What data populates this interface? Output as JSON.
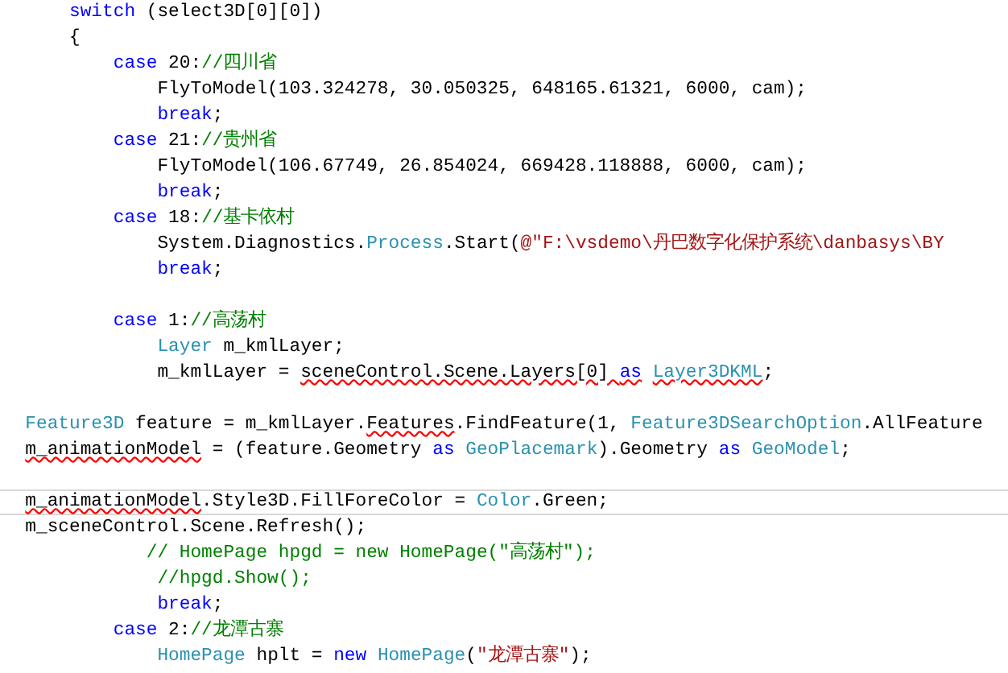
{
  "editor": {
    "lines": [
      {
        "current": false,
        "tokens": [
          {
            "text": "      switch",
            "kind": "kw",
            "error": false
          },
          {
            "text": " (select3D[0][0])",
            "kind": "tx",
            "error": false
          }
        ]
      },
      {
        "current": false,
        "tokens": [
          {
            "text": "      {",
            "kind": "tx",
            "error": false
          }
        ]
      },
      {
        "current": false,
        "tokens": [
          {
            "text": "          case",
            "kind": "kw",
            "error": false
          },
          {
            "text": " 20:",
            "kind": "tx",
            "error": false
          },
          {
            "text": "//四川省",
            "kind": "cm",
            "error": false
          }
        ]
      },
      {
        "current": false,
        "tokens": [
          {
            "text": "              FlyToModel(103.324278, 30.050325, 648165.61321, 6000, cam);",
            "kind": "tx",
            "error": false
          }
        ]
      },
      {
        "current": false,
        "tokens": [
          {
            "text": "              break",
            "kind": "kw",
            "error": false
          },
          {
            "text": ";",
            "kind": "tx",
            "error": false
          }
        ]
      },
      {
        "current": false,
        "tokens": [
          {
            "text": "          case",
            "kind": "kw",
            "error": false
          },
          {
            "text": " 21:",
            "kind": "tx",
            "error": false
          },
          {
            "text": "//贵州省",
            "kind": "cm",
            "error": false
          }
        ]
      },
      {
        "current": false,
        "tokens": [
          {
            "text": "              FlyToModel(106.67749, 26.854024, 669428.118888, 6000, cam);",
            "kind": "tx",
            "error": false
          }
        ]
      },
      {
        "current": false,
        "tokens": [
          {
            "text": "              break",
            "kind": "kw",
            "error": false
          },
          {
            "text": ";",
            "kind": "tx",
            "error": false
          }
        ]
      },
      {
        "current": false,
        "tokens": [
          {
            "text": "          case",
            "kind": "kw",
            "error": false
          },
          {
            "text": " 18:",
            "kind": "tx",
            "error": false
          },
          {
            "text": "//基卡依村",
            "kind": "cm",
            "error": false
          }
        ]
      },
      {
        "current": false,
        "tokens": [
          {
            "text": "              System.Diagnostics.",
            "kind": "tx",
            "error": false
          },
          {
            "text": "Process",
            "kind": "ty",
            "error": false
          },
          {
            "text": ".Start(",
            "kind": "tx",
            "error": false
          },
          {
            "text": "@\"F:\\vsdemo\\丹巴数字化保护系统\\danbasys\\BY",
            "kind": "str",
            "error": false
          }
        ]
      },
      {
        "current": false,
        "tokens": [
          {
            "text": "              break",
            "kind": "kw",
            "error": false
          },
          {
            "text": ";",
            "kind": "tx",
            "error": false
          }
        ]
      },
      {
        "current": false
      },
      {
        "current": false,
        "tokens": [
          {
            "text": "          case",
            "kind": "kw",
            "error": false
          },
          {
            "text": " 1:",
            "kind": "tx",
            "error": false
          },
          {
            "text": "//高荡村",
            "kind": "cm",
            "error": false
          }
        ]
      },
      {
        "current": false,
        "tokens": [
          {
            "text": "              Layer",
            "kind": "ty",
            "error": false
          },
          {
            "text": " m_kmlLayer;",
            "kind": "tx",
            "error": false
          }
        ]
      },
      {
        "current": false,
        "tokens": [
          {
            "text": "              m_kmlLayer = ",
            "kind": "tx",
            "error": false
          },
          {
            "text": "sceneControl.Scene.Layers[0] ",
            "kind": "tx",
            "error": true
          },
          {
            "text": "as",
            "kind": "kw",
            "error": true
          },
          {
            "text": " Layer3DKML",
            "kind": "ty",
            "error": true
          },
          {
            "text": ";",
            "kind": "tx",
            "error": false
          }
        ]
      },
      {
        "current": false
      },
      {
        "current": false,
        "tokens": [
          {
            "text": "  Feature3D",
            "kind": "ty",
            "error": false
          },
          {
            "text": " feature = m_kmlLayer.",
            "kind": "tx",
            "error": false
          },
          {
            "text": "Features",
            "kind": "tx",
            "error": true
          },
          {
            "text": ".FindFeature(1, ",
            "kind": "tx",
            "error": false
          },
          {
            "text": "Feature3DSearchOption",
            "kind": "ty",
            "error": false
          },
          {
            "text": ".AllFeature",
            "kind": "tx",
            "error": false
          }
        ]
      },
      {
        "current": false,
        "tokens": [
          {
            "text": "  m_animationModel",
            "kind": "tx",
            "error": true
          },
          {
            "text": " = (feature.Geometry ",
            "kind": "tx",
            "error": false
          },
          {
            "text": "as",
            "kind": "kw",
            "error": false
          },
          {
            "text": " GeoPlacemark",
            "kind": "ty",
            "error": false
          },
          {
            "text": ").Geometry ",
            "kind": "tx",
            "error": false
          },
          {
            "text": "as",
            "kind": "kw",
            "error": false
          },
          {
            "text": " GeoModel",
            "kind": "ty",
            "error": false
          },
          {
            "text": ";",
            "kind": "tx",
            "error": false
          }
        ]
      },
      {
        "current": false
      },
      {
        "current": true,
        "tokens": [
          {
            "text": "  m_animationModel",
            "kind": "tx",
            "error": true
          },
          {
            "text": ".Style3D.FillForeColor = ",
            "kind": "tx",
            "error": false
          },
          {
            "text": "Color",
            "kind": "ty",
            "error": false
          },
          {
            "text": ".Green;",
            "kind": "tx",
            "error": false
          }
        ]
      },
      {
        "current": false,
        "tokens": [
          {
            "text": "  m_sceneControl.Scene.Refresh();",
            "kind": "tx",
            "error": false
          }
        ]
      },
      {
        "current": false,
        "tokens": [
          {
            "text": "             // HomePage hpgd = new HomePage(\"高荡村\");",
            "kind": "cm",
            "error": false
          }
        ]
      },
      {
        "current": false,
        "tokens": [
          {
            "text": "              //hpgd.Show();",
            "kind": "cm",
            "error": false
          }
        ]
      },
      {
        "current": false,
        "tokens": [
          {
            "text": "              break",
            "kind": "kw",
            "error": false
          },
          {
            "text": ";",
            "kind": "tx",
            "error": false
          }
        ]
      },
      {
        "current": false,
        "tokens": [
          {
            "text": "          case",
            "kind": "kw",
            "error": false
          },
          {
            "text": " 2:",
            "kind": "tx",
            "error": false
          },
          {
            "text": "//龙潭古寨",
            "kind": "cm",
            "error": false
          }
        ]
      },
      {
        "current": false,
        "tokens": [
          {
            "text": "              HomePage",
            "kind": "ty",
            "error": false
          },
          {
            "text": " hplt = ",
            "kind": "tx",
            "error": false
          },
          {
            "text": "new",
            "kind": "kw",
            "error": false
          },
          {
            "text": " HomePage",
            "kind": "ty",
            "error": false
          },
          {
            "text": "(",
            "kind": "tx",
            "error": false
          },
          {
            "text": "\"龙潭古寨\"",
            "kind": "str",
            "error": false
          },
          {
            "text": ");",
            "kind": "tx",
            "error": false
          }
        ]
      }
    ]
  }
}
